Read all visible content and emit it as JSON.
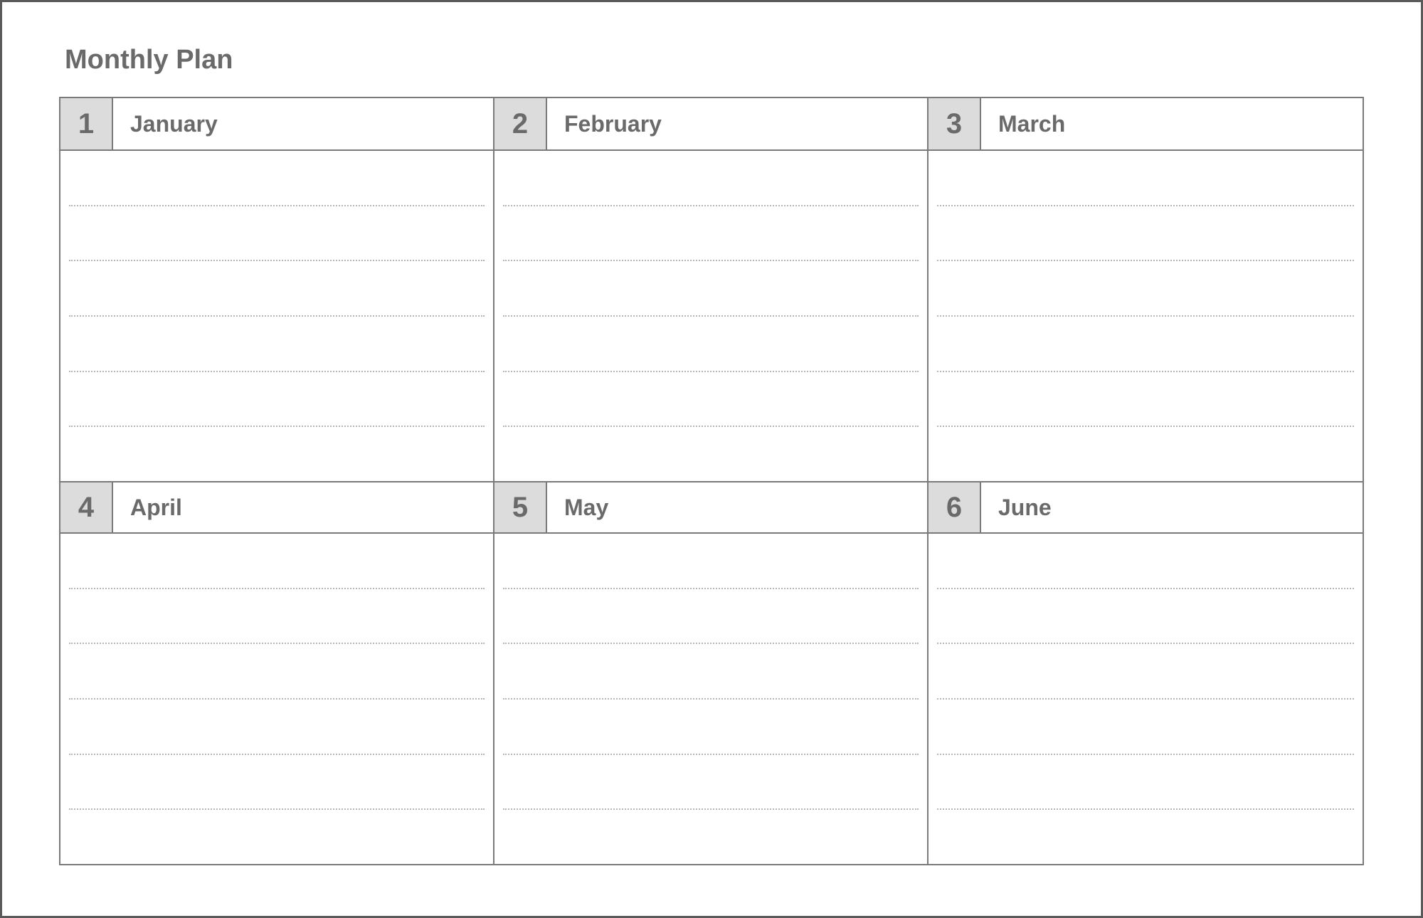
{
  "title": "Monthly Plan",
  "months": [
    {
      "num": "1",
      "name": "January"
    },
    {
      "num": "2",
      "name": "February"
    },
    {
      "num": "3",
      "name": "March"
    },
    {
      "num": "4",
      "name": "April"
    },
    {
      "num": "5",
      "name": "May"
    },
    {
      "num": "6",
      "name": "June"
    }
  ]
}
